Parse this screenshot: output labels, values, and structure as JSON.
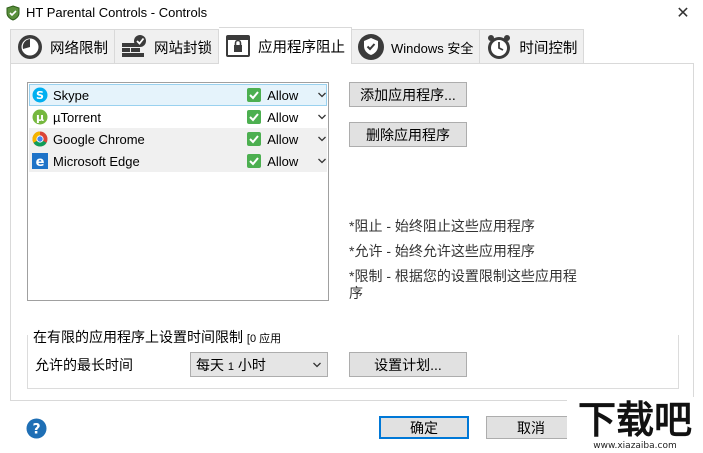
{
  "window": {
    "title": "HT Parental Controls - Controls",
    "close_glyph": "✕"
  },
  "tabs": [
    {
      "label": "网络限制",
      "icon": "speedometer-icon"
    },
    {
      "label": "网站封锁",
      "icon": "firewall-icon"
    },
    {
      "label": "应用程序阻止",
      "icon": "window-lock-icon",
      "active": true
    },
    {
      "label": "Windows 安全",
      "icon": "shield-check-icon"
    },
    {
      "label": "时间控制",
      "icon": "alarm-clock-icon"
    }
  ],
  "apps": [
    {
      "name": "Skype",
      "icon": "skype-icon",
      "status": "Allow"
    },
    {
      "name": "µTorrent",
      "icon": "utorrent-icon",
      "status": "Allow"
    },
    {
      "name": "Google Chrome",
      "icon": "chrome-icon",
      "status": "Allow"
    },
    {
      "name": "Microsoft Edge",
      "icon": "edge-icon",
      "status": "Allow"
    }
  ],
  "buttons": {
    "add_app": "添加应用程序...",
    "remove_app": "删除应用程序",
    "schedule": "设置计划...",
    "ok": "确定",
    "cancel": "取消"
  },
  "legend": {
    "block": "*阻止 - 始终阻止这些应用程序",
    "allow": "*允许 - 始终允许这些应用程序",
    "limit": "*限制 - 根据您的设置限制这些应用程序"
  },
  "time_limit": {
    "group_label": "在有限的应用程序上设置时间限制",
    "group_count": "[0 应用",
    "max_time_label": "允许的最长时间",
    "select_value_prefix": "每天",
    "select_value_num": "1",
    "select_value_suffix": "小时"
  },
  "watermark": {
    "text": "下载吧",
    "url": "www.xiazaiba.com"
  },
  "colors": {
    "accent": "#0078d7",
    "selected_row": "#e5f3fb",
    "allow_green": "#4caf50",
    "help_blue": "#1f6fb5"
  }
}
